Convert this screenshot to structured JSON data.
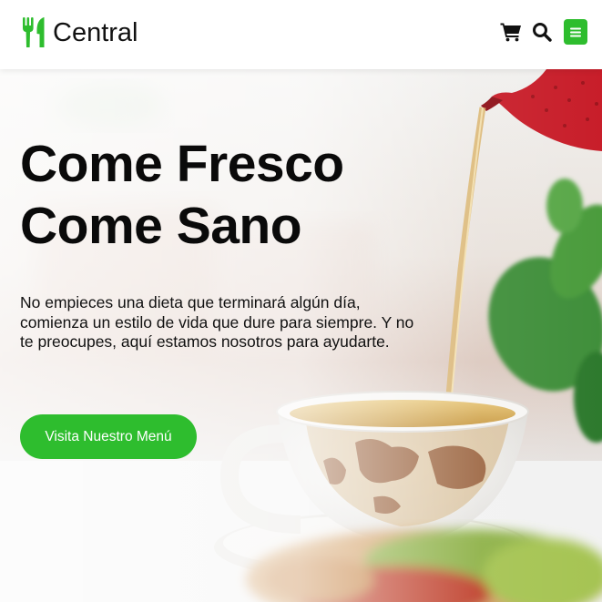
{
  "colors": {
    "accent": "#2ebd2e",
    "text": "#0a0a0a",
    "header_bg": "#ffffff"
  },
  "header": {
    "brand_name": "Central",
    "logo_icon": "fork-knife-icon",
    "icons": [
      "cart-icon",
      "search-icon",
      "menu-icon"
    ]
  },
  "hero": {
    "title_line1": "Come Fresco",
    "title_line2": "Come Sano",
    "description": "No empieces una dieta que terminará algún día, comienza un estilo de vida que dure para siempre. Y no te preocupes, aquí estamos nosotros para ayudarte.",
    "cta_label": "Visita Nuestro Menú"
  }
}
